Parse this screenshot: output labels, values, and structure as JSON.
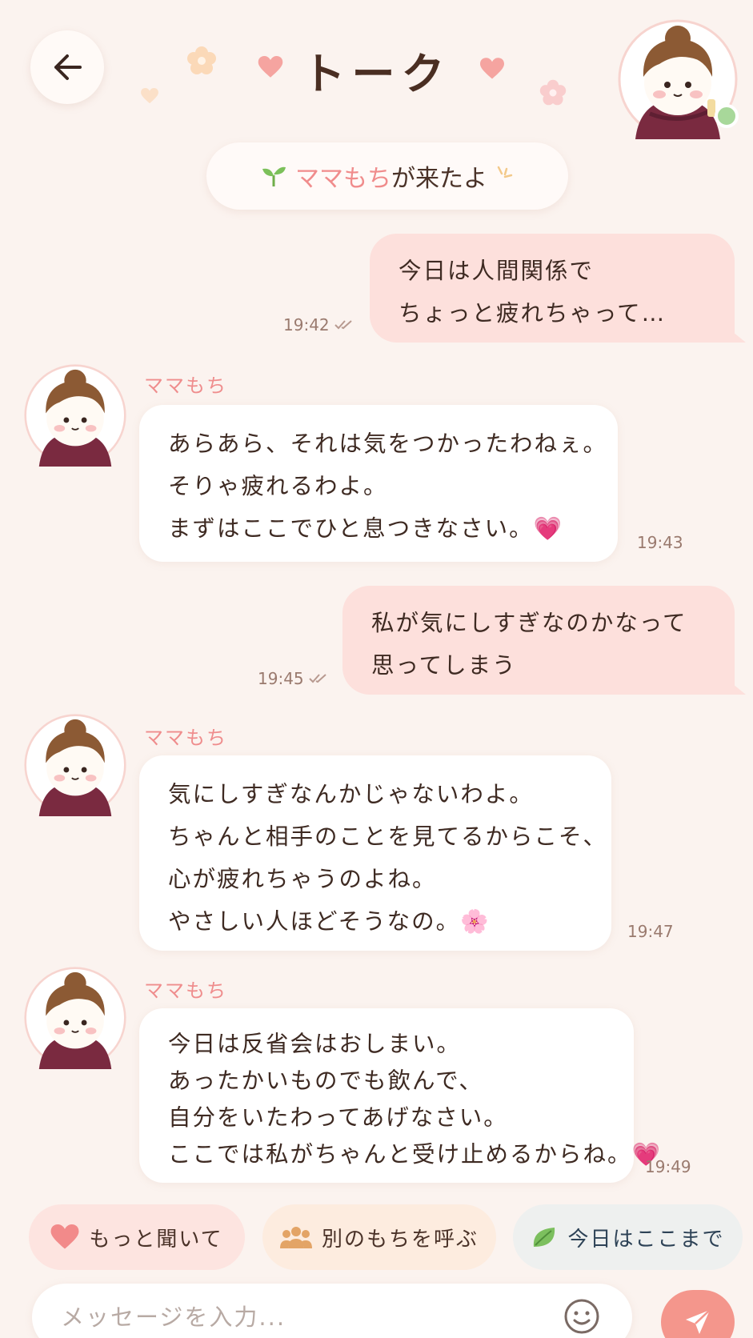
{
  "header": {
    "title": "トーク"
  },
  "system": {
    "name": "ママもち",
    "suffix": "が来たよ"
  },
  "messages": [
    {
      "from": "me",
      "lines": [
        "今日は人間関係で",
        "ちょっと疲れちゃって…"
      ],
      "time": "19:42"
    },
    {
      "from": "ママもち",
      "sender": "ママもち",
      "lines": [
        "あらあら、それは気をつかったわねぇ。",
        "そりゃ疲れるわよ。",
        "まずはここでひと息つきなさい。"
      ],
      "emoji": "💗",
      "time": "19:43"
    },
    {
      "from": "me",
      "lines": [
        "私が気にしすぎなのかなって",
        "思ってしまう"
      ],
      "time": "19:45"
    },
    {
      "from": "ママもち",
      "sender": "ママもち",
      "lines": [
        "気にしすぎなんかじゃないわよ。",
        "ちゃんと相手のことを見てるからこそ、",
        "心が疲れちゃうのよね。",
        "やさしい人ほどそうなの。"
      ],
      "emoji": "🌸",
      "time": "19:47"
    },
    {
      "from": "ママもち",
      "sender": "ママもち",
      "lines": [
        "今日は反省会はおしまい。",
        "あったかいものでも飲んで、",
        "自分をいたわってあげなさい。",
        "ここでは私がちゃんと受け止めるからね。"
      ],
      "emoji": "💗",
      "time": "19:49"
    }
  ],
  "quick_replies": [
    {
      "label": "もっと聞いて",
      "icon": "heart-icon"
    },
    {
      "label": "別のもちを呼ぶ",
      "icon": "people-icon"
    },
    {
      "label": "今日はここまで",
      "icon": "leaf-icon"
    }
  ],
  "input": {
    "placeholder": "メッセージを入力..."
  },
  "colors": {
    "accent": "#f08c8c",
    "my_bubble": "#fde0dc",
    "send": "#f4968c",
    "background": "#fbf3ef"
  }
}
